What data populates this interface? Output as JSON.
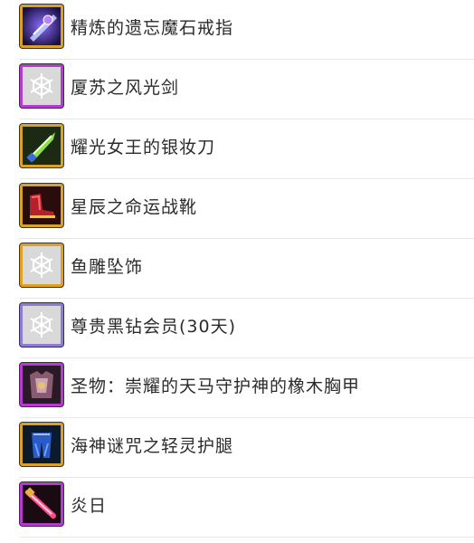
{
  "items": [
    {
      "label": "精炼的遗忘魔石戒指",
      "icon": "ring-icon",
      "border": "#d8a22a"
    },
    {
      "label": "厦苏之风光剑",
      "icon": "placeholder-snowflake-icon",
      "border": "#b43ad0"
    },
    {
      "label": "耀光女王的银妆刀",
      "icon": "dagger-icon",
      "border": "#d8a22a"
    },
    {
      "label": "星辰之命运战靴",
      "icon": "boots-icon",
      "border": "#d8a22a"
    },
    {
      "label": "鱼雕坠饰",
      "icon": "placeholder-snowflake-icon",
      "border": "#e0a020"
    },
    {
      "label": "尊贵黑钻会员(30天)",
      "icon": "placeholder-snowflake-icon",
      "border": "#8e7bd6"
    },
    {
      "label": "圣物：崇耀的天马守护神的橡木胸甲",
      "icon": "armor-icon",
      "border": "#b43ad0"
    },
    {
      "label": "海神谜咒之轻灵护腿",
      "icon": "leggings-icon",
      "border": "#d8a22a"
    },
    {
      "label": "炎日",
      "icon": "flame-sword-icon",
      "border": "#b43ad0"
    }
  ]
}
